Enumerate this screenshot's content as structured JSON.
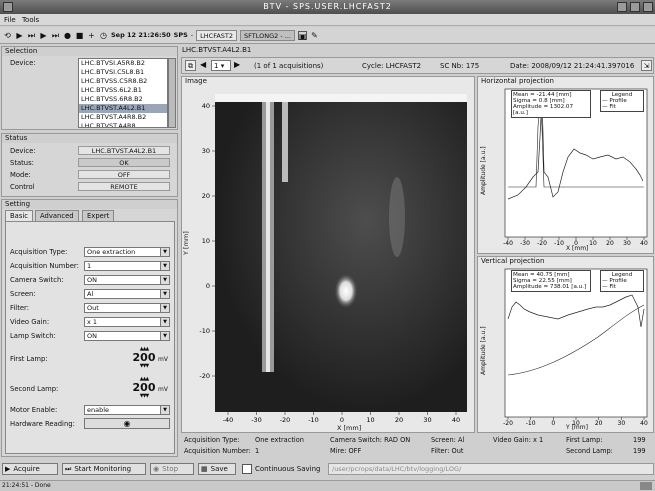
{
  "window": {
    "title": "BTV - SPS.USER.LHCFAST2"
  },
  "menu": [
    "File",
    "Tools"
  ],
  "toolbar": {
    "datetime": "Sep 12 21:26:50",
    "machine": "SPS",
    "user": "LHCFAST2",
    "cycle_box": "SFTLONG2 - ..."
  },
  "selection": {
    "title": "Selection",
    "device_label": "Device:",
    "devices": [
      "LHC.BTVSI.A5R8.B2",
      "LHC.BTVSI.C5L8.B1",
      "LHC.BTVSS.C5R8.B2",
      "LHC.BTVSS.6L2.B1",
      "LHC.BTVSS.6R8.B2",
      "LHC.BTVST.A4L2.B1",
      "LHC.BTVST.A4R8.B2",
      "LHC.BTVST.A4R8"
    ],
    "selected_index": 5
  },
  "status": {
    "title": "Status",
    "device_label": "Device:",
    "device": "LHC.BTVST.A4L2.B1",
    "status_label": "Status:",
    "status": "OK",
    "mode_label": "Mode:",
    "mode": "OFF",
    "control_label": "Control",
    "control": "REMOTE"
  },
  "setting": {
    "title": "Setting",
    "tabs": [
      "Basic",
      "Advanced",
      "Expert"
    ],
    "rows": [
      {
        "label": "Acquisition Type:",
        "value": "One extraction"
      },
      {
        "label": "Acquisition Number:",
        "value": "1"
      },
      {
        "label": "Camera Switch:",
        "value": "ON"
      },
      {
        "label": "Screen:",
        "value": "Al"
      },
      {
        "label": "Filter:",
        "value": "Out"
      },
      {
        "label": "Video Gain:",
        "value": "x 1"
      },
      {
        "label": "Lamp Switch:",
        "value": "ON"
      }
    ],
    "first_lamp_label": "First Lamp:",
    "first_lamp": "200",
    "lamp_unit": "mV",
    "second_lamp_label": "Second Lamp:",
    "second_lamp": "200",
    "motor_label": "Motor Enable:",
    "motor": "enable",
    "hardware_label": "Hardware Reading:"
  },
  "header": {
    "device": "LHC.BTVST.A4L2.B1",
    "page": "1",
    "acq_info": "(1 of 1 acquisitions)",
    "cycle": "Cycle: LHCFAST2",
    "sc": "SC Nb: 175",
    "date": "Date: 2008/09/12 21:24:41.397016"
  },
  "image": {
    "title": "Image",
    "xlabel": "X [mm]",
    "ylabel": "Y [mm]",
    "xticks": [
      "-40",
      "-30",
      "-20",
      "-10",
      "0",
      "10",
      "20",
      "30",
      "40"
    ],
    "yticks": [
      "40",
      "30",
      "20",
      "10",
      "0",
      "-10",
      "-20"
    ]
  },
  "hproj": {
    "title": "Horizontal projection",
    "stats": [
      "Mean = -21.44 [mm]",
      "Sigma = 0.8 [mm]",
      "Amplitude = 1302.07 [a.u.]"
    ],
    "legend_title": "Legend",
    "legend": [
      "Profile",
      "Fit"
    ],
    "ylabel": "Amplitude [a.u.]",
    "xlabel": "X [mm]",
    "xticks": [
      "-40",
      "-30",
      "-20",
      "-10",
      "0",
      "10",
      "20",
      "30",
      "40"
    ]
  },
  "vproj": {
    "title": "Vertical projection",
    "stats": [
      "Mean = 40.75 [mm]",
      "Sigma = 22.55 [mm]",
      "Amplitude = 738.01 [a.u.]"
    ],
    "legend_title": "Legend",
    "legend": [
      "Profile",
      "Fit"
    ],
    "ylabel": "Amplitude [a.u.]",
    "xlabel": "Y [mm]",
    "xticks": [
      "-20",
      "-10",
      "0",
      "10",
      "20",
      "30",
      "40"
    ]
  },
  "info": {
    "acq_type_label": "Acquisition Type:",
    "acq_type": "One extraction",
    "acq_num_label": "Acquisition Number:",
    "acq_num": "1",
    "camera": "Camera Switch: RAD ON",
    "mire": "Mire: OFF",
    "screen": "Screen: Al",
    "filter": "Filter: Out",
    "video": "Video Gain: x 1",
    "first_lamp": "First Lamp:",
    "first_lamp_val": "199",
    "second_lamp": "Second Lamp:",
    "second_lamp_val": "199"
  },
  "bottom": {
    "acquire": "Acquire",
    "monitor": "Start Monitoring",
    "stop": "Stop",
    "save": "Save",
    "continuous": "Continuous Saving",
    "path": "/user/pcrops/data/LHC/btv/logging/LOG/"
  },
  "statusbar": {
    "text": "21:24:51 - Done"
  }
}
